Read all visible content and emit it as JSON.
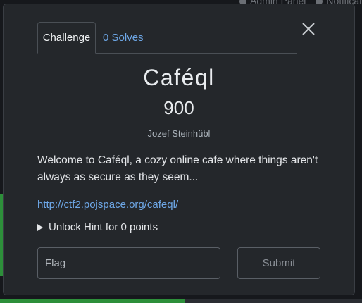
{
  "background": {
    "nav": [
      {
        "label": "Admin Panel",
        "icon": "wrench-icon"
      },
      {
        "label": "Notificat",
        "icon": "bell-icon"
      }
    ]
  },
  "modal": {
    "tabs": [
      {
        "label": "Challenge",
        "active": true
      },
      {
        "label": "0 Solves",
        "active": false
      }
    ],
    "title": "Caféql",
    "points": "900",
    "author": "Jozef Steinhübl",
    "description": "Welcome to Caféql, a cozy online cafe where things aren't always as secure as they seem...",
    "link": "http://ctf2.pojspace.org/cafeql/",
    "hint": "Unlock Hint for 0 points",
    "flag_placeholder": "Flag",
    "submit_label": "Submit"
  },
  "colors": {
    "modal_bg": "#24272b",
    "link": "#6ea8e8",
    "text": "#e4e6e9",
    "accent_green": "#2d8f3a"
  }
}
